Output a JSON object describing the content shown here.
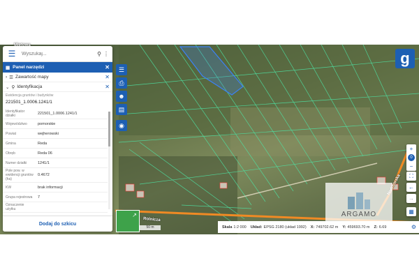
{
  "search": {
    "placeholder": "Wyszukaj..."
  },
  "panel": {
    "title": "Panel narzędzi",
    "sections": [
      {
        "label": "Zawartość mapy"
      },
      {
        "label": "Identyfikacja"
      }
    ],
    "layer": "Ewidencja gruntów i budynków",
    "parcel_id": "221501_1.0006.1241/1",
    "attributes": [
      {
        "key": "Identyfikator działki",
        "value": "221501_1.0006.1241/1"
      },
      {
        "key": "Województwo",
        "value": "pomorskie"
      },
      {
        "key": "Powiat",
        "value": "wejherowski"
      },
      {
        "key": "Gmina",
        "value": "Reda"
      },
      {
        "key": "Obręb",
        "value": "Reda 06"
      },
      {
        "key": "Numer działki",
        "value": "1241/1"
      },
      {
        "key": "Pole pow. w ewidencji gruntów (ha)",
        "value": "0.4672"
      },
      {
        "key": "KW",
        "value": "brak informacji"
      },
      {
        "key": "Grupa rejestrowa",
        "value": "7"
      },
      {
        "key": "Oznaczenie użytku",
        "value": ""
      }
    ],
    "add_button": "Dodaj do szkicu"
  },
  "map": {
    "streets": [
      "Rolnicza",
      "Nadmorska",
      "Miętowa"
    ],
    "watermark": "ARGAMO",
    "scale_bar": "50 m",
    "zoom_level": "0"
  },
  "status": {
    "scale_label": "Skala",
    "scale_value": "1:2 000",
    "crs_label": "Układ:",
    "crs_value": "EPSG 2180 (układ 1992)",
    "x_label": "X:",
    "x_value": "749702.62 m",
    "y_label": "Y:",
    "y_value": "459693.70 m",
    "z_label": "Z:",
    "z_value": "6.69"
  },
  "icons": [
    "menu-icon",
    "search-icon",
    "more-icon",
    "grid-icon",
    "close-icon",
    "layers-icon",
    "print-icon",
    "person-icon",
    "clipboard-icon",
    "camera-icon",
    "geoportal-logo",
    "zoom-in-icon",
    "zoom-out-icon",
    "fullscreen-icon",
    "back-icon",
    "forward-icon",
    "share-icon",
    "gear-icon"
  ],
  "colors": {
    "accent": "#1d5fb3",
    "parcel_lines": "#4de6a6",
    "road": "#f08a24",
    "selected_parcel": "#3b82f6"
  }
}
